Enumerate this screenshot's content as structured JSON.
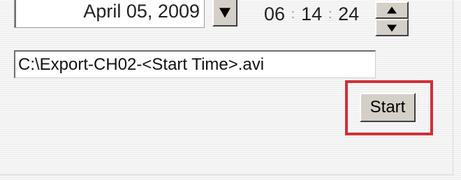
{
  "date_picker": {
    "value": "April 05, 2009",
    "dropdown_icon": "triangle-down-icon"
  },
  "time_picker": {
    "hours": "06",
    "minutes": "14",
    "seconds": "24",
    "separator": ":",
    "spin_up_icon": "triangle-up-icon",
    "spin_down_icon": "triangle-down-icon"
  },
  "export": {
    "path_value": "C:\\Export-CH02-<Start Time>.avi"
  },
  "actions": {
    "start_label": "Start"
  },
  "colors": {
    "highlight": "#d0303a",
    "button_face": "#d4d0c8",
    "background": "#f4f4f4"
  }
}
